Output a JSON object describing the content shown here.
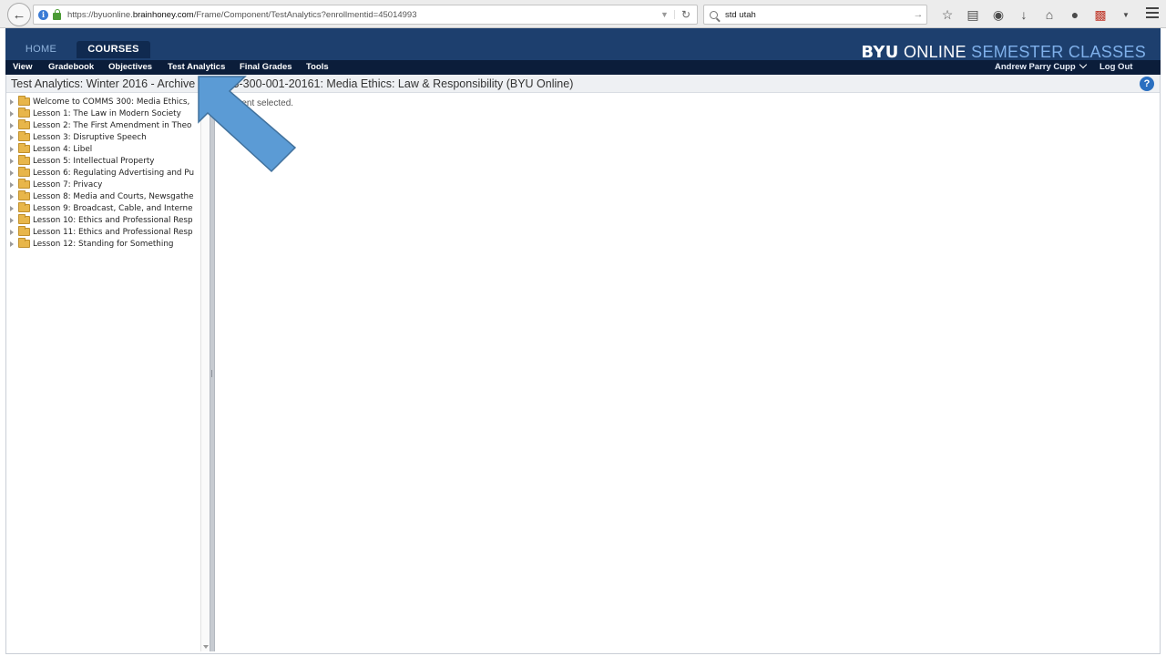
{
  "browser": {
    "url_prefix": "https://byuonline.",
    "url_domain": "brainhoney.com",
    "url_path": "/Frame/Component/TestAnalytics?enrollmentid=45014993",
    "search_query": "std utah"
  },
  "header": {
    "tabs": [
      {
        "label": "HOME"
      },
      {
        "label": "COURSES"
      }
    ],
    "brand": {
      "byu": "BYU",
      "online": "ONLINE",
      "semester": "SEMESTER CLASSES"
    }
  },
  "nav": {
    "items": [
      {
        "label": "View"
      },
      {
        "label": "Gradebook"
      },
      {
        "label": "Objectives"
      },
      {
        "label": "Test Analytics"
      },
      {
        "label": "Final Grades"
      },
      {
        "label": "Tools"
      }
    ],
    "user": "Andrew Parry Cupp",
    "logout": "Log Out"
  },
  "page": {
    "title_left": "Test Analytics: Winter 2016 - Archive",
    "title_right": "S-300-001-20161: Media Ethics: Law & Responsibility (BYU Online)",
    "message": "ssment selected."
  },
  "tree": {
    "items": [
      {
        "label": "Welcome to COMMS 300: Media Ethics,"
      },
      {
        "label": "Lesson 1: The Law in Modern Society"
      },
      {
        "label": "Lesson 2: The First Amendment in Theo"
      },
      {
        "label": "Lesson 3: Disruptive Speech"
      },
      {
        "label": "Lesson 4: Libel"
      },
      {
        "label": "Lesson 5: Intellectual Property"
      },
      {
        "label": "Lesson 6: Regulating Advertising and Pu"
      },
      {
        "label": "Lesson 7: Privacy"
      },
      {
        "label": "Lesson 8: Media and Courts, Newsgathe"
      },
      {
        "label": "Lesson 9: Broadcast, Cable, and Interne"
      },
      {
        "label": "Lesson 10: Ethics and Professional Resp"
      },
      {
        "label": "Lesson 11: Ethics and Professional Resp"
      },
      {
        "label": "Lesson 12: Standing for Something"
      }
    ]
  },
  "colors": {
    "header_bg": "#1d3f6e",
    "nav_bg": "#0b1d3a",
    "annotation_arrow": "#5b9bd5"
  }
}
